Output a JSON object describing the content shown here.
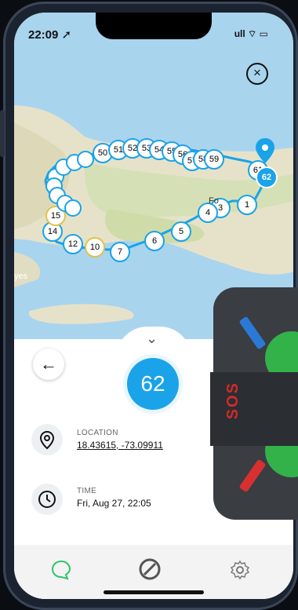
{
  "status_bar": {
    "time": "22:09 ➚",
    "system_icons": "ull ⌔ ▭"
  },
  "map": {
    "place_labels": [
      "Fo",
      "yes"
    ],
    "markers": [
      "62",
      "1",
      "3",
      "4",
      "5",
      "6",
      "7",
      "10",
      "12",
      "14",
      "15",
      "50",
      "51",
      "52",
      "53",
      "54",
      "55",
      "56",
      "57",
      "58",
      "59",
      "60",
      "61"
    ],
    "current_point_label": "62",
    "close_icon": "close-icon"
  },
  "detail": {
    "point_number": "62",
    "location_label": "LOCATION",
    "location_value": "18.43615, -73.09911",
    "time_label": "TIME",
    "time_value": "Fri, Aug 27, 22:05"
  },
  "device": {
    "label": "SOS"
  },
  "colors": {
    "accent": "#1aa3e8",
    "map_water": "#a9d4ee",
    "map_land": "#e6e2c9",
    "chat_green": "#2fc46b"
  }
}
